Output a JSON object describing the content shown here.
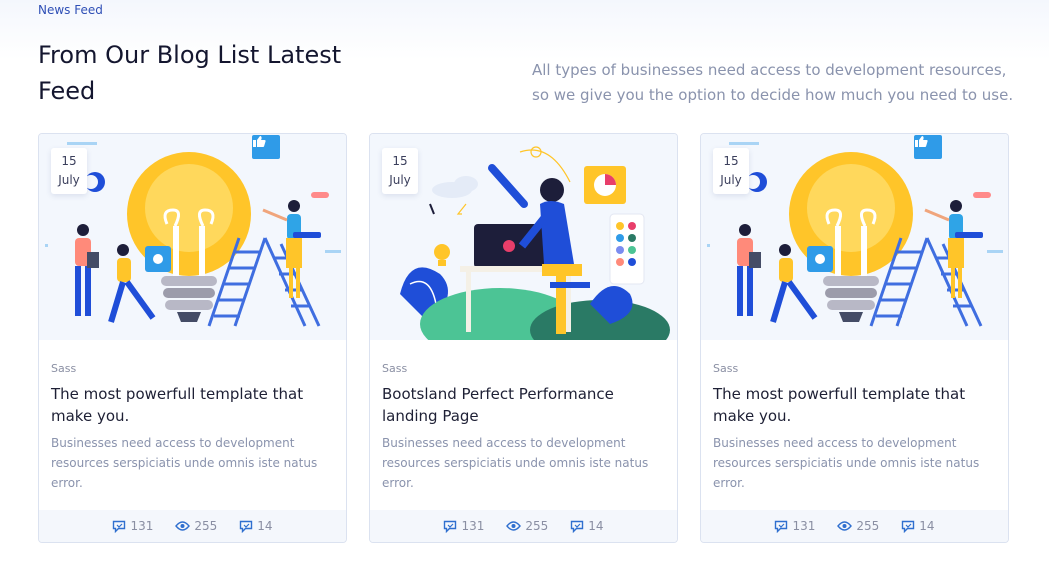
{
  "section": {
    "eyebrow": "News Feed",
    "title": "From Our Blog List Latest Feed",
    "description": "All types of businesses need access to development resources, so we give you the option to decide how much you need to use."
  },
  "cards": [
    {
      "illustration": "lightbulb-team",
      "date_day": "15",
      "date_month": "July",
      "category": "Sass",
      "title": "The most powerfull template that make you.",
      "excerpt": "Businesses need access to development resources serspiciatis unde omnis iste natus error.",
      "comments": "131",
      "views": "255",
      "shares": "14"
    },
    {
      "illustration": "laptop-worker",
      "date_day": "15",
      "date_month": "July",
      "category": "Sass",
      "title": "Bootsland Perfect Performance landing Page",
      "excerpt": "Businesses need access to development resources serspiciatis unde omnis iste natus error.",
      "comments": "131",
      "views": "255",
      "shares": "14"
    },
    {
      "illustration": "lightbulb-team",
      "date_day": "15",
      "date_month": "July",
      "category": "Sass",
      "title": "The most powerfull template that make you.",
      "excerpt": "Businesses need access to development resources serspiciatis unde omnis iste natus error.",
      "comments": "131",
      "views": "255",
      "shares": "14"
    }
  ],
  "colors": {
    "accent": "#2f4fb6",
    "like_button": "#2f9be8",
    "bulb_yellow": "#ffc529"
  }
}
